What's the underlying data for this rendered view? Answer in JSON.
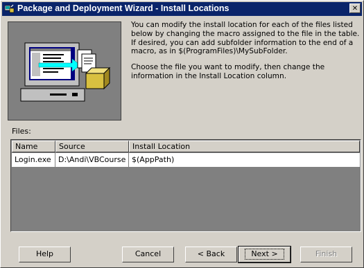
{
  "window": {
    "title": "Package and Deployment Wizard - Install Locations",
    "close_glyph": "✕"
  },
  "description": {
    "paragraph1": "You can modify the install location for each of the files listed below by changing the macro assigned to the file in the table. If desired, you can add subfolder information to the end of a macro, as in $(ProgramFiles)\\MySubFolder.",
    "paragraph2": "Choose the file you want to modify, then change the information in the Install Location column."
  },
  "files": {
    "label": "Files:",
    "columns": [
      "Name",
      "Source",
      "Install Location"
    ],
    "rows": [
      {
        "name": "Login.exe",
        "source": "D:\\Andi\\VBCourse",
        "install_location": "$(AppPath)"
      }
    ]
  },
  "buttons": {
    "help": "Help",
    "cancel": "Cancel",
    "back": "< Back",
    "next": "Next >",
    "finish": "Finish"
  },
  "icons": {
    "title_icon": "package-wizard-icon",
    "illustration": "computer-with-files-package-illustration"
  },
  "colors": {
    "titlebar": "#0a246a",
    "face": "#d4d0c8",
    "illustration_bg": "#808080",
    "list_bg": "#808080"
  }
}
